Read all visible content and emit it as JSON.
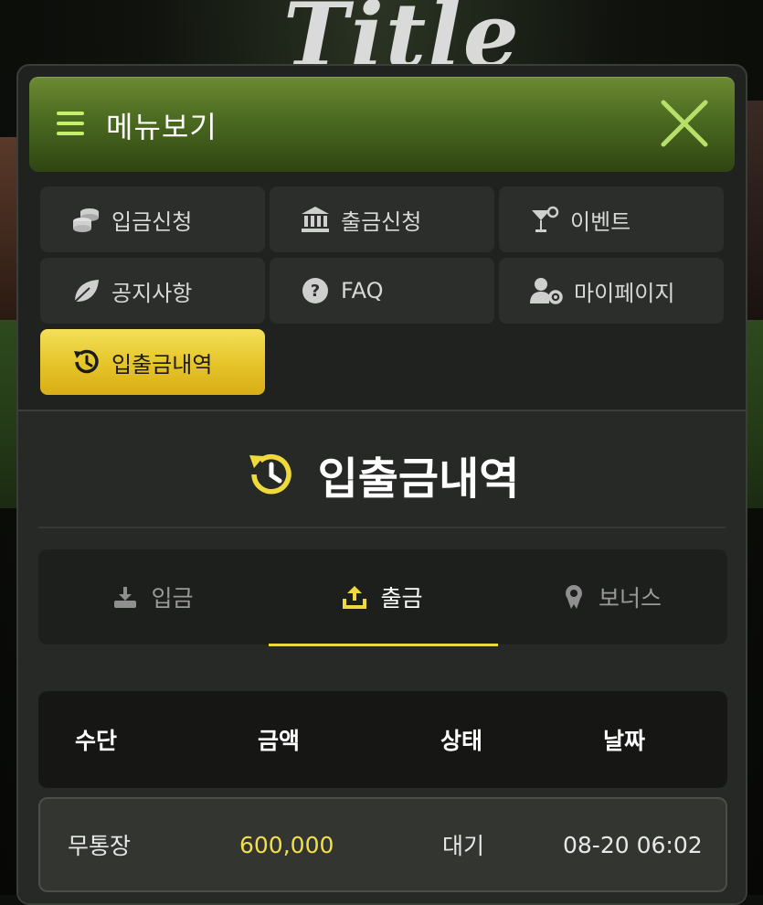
{
  "background": {
    "logo_text": "Title"
  },
  "menu": {
    "title": "메뉴보기",
    "items": [
      {
        "label": "입금신청",
        "icon": "coins-icon"
      },
      {
        "label": "출금신청",
        "icon": "bank-icon"
      },
      {
        "label": "이벤트",
        "icon": "cocktail-icon"
      },
      {
        "label": "공지사항",
        "icon": "leaf-icon"
      },
      {
        "label": "FAQ",
        "icon": "question-circle-icon"
      },
      {
        "label": "마이페이지",
        "icon": "user-gear-icon"
      },
      {
        "label": "입출금내역",
        "icon": "history-icon",
        "active": true
      }
    ]
  },
  "history": {
    "title": "입출금내역",
    "tabs": [
      {
        "label": "입금",
        "icon": "download-icon"
      },
      {
        "label": "출금",
        "icon": "upload-icon",
        "active": true
      },
      {
        "label": "보너스",
        "icon": "award-icon"
      }
    ],
    "columns": [
      "수단",
      "금액",
      "상태",
      "날짜"
    ],
    "rows": [
      {
        "method": "무통장",
        "amount": "600,000",
        "status": "대기",
        "date": "08-20 06:02"
      }
    ]
  },
  "colors": {
    "accent_yellow": "#f0d93b",
    "header_green": "#4b6a20",
    "close_icon_green": "#b6e06a"
  }
}
